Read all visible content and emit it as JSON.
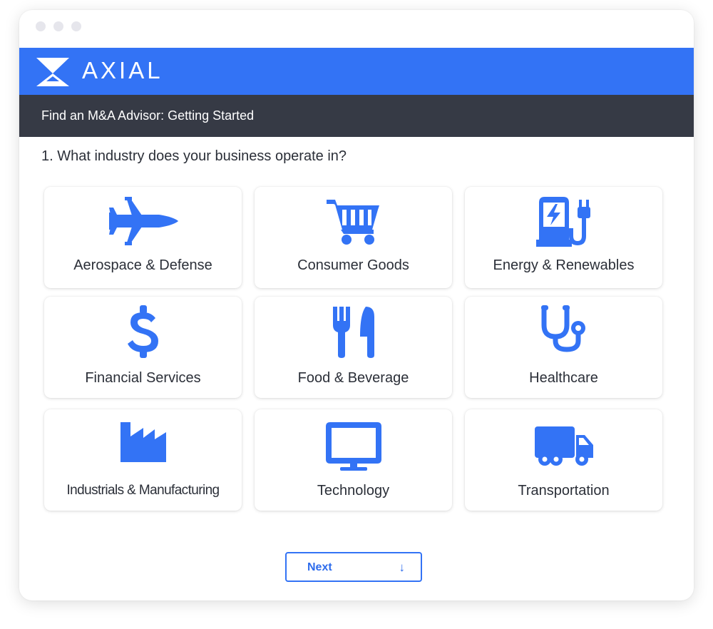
{
  "brand": {
    "name": "AXIAL",
    "color": "#3373f5"
  },
  "header": {
    "title": "Find an M&A Advisor: Getting Started"
  },
  "question": {
    "text": "1. What industry does your business operate in?"
  },
  "industries": [
    {
      "label": "Aerospace & Defense",
      "icon": "fighter-jet-icon"
    },
    {
      "label": "Consumer Goods",
      "icon": "shopping-cart-icon"
    },
    {
      "label": "Energy & Renewables",
      "icon": "ev-charger-icon"
    },
    {
      "label": "Financial Services",
      "icon": "dollar-sign-icon"
    },
    {
      "label": "Food & Beverage",
      "icon": "fork-knife-icon"
    },
    {
      "label": "Healthcare",
      "icon": "stethoscope-icon"
    },
    {
      "label": "Industrials & Manufacturing",
      "icon": "factory-icon"
    },
    {
      "label": "Technology",
      "icon": "monitor-icon"
    },
    {
      "label": "Transportation",
      "icon": "truck-icon"
    }
  ],
  "actions": {
    "next_label": "Next",
    "next_icon": "arrow-down-icon"
  }
}
